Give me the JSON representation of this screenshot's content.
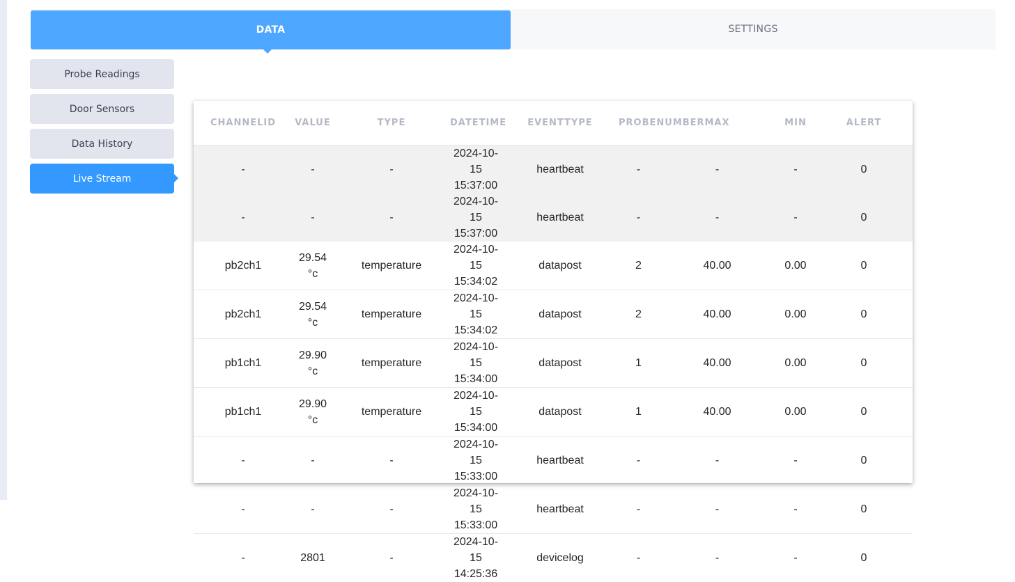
{
  "tabs": {
    "data": "DATA",
    "settings": "SETTINGS"
  },
  "subnav": {
    "probe_readings": "Probe Readings",
    "door_sensors": "Door Sensors",
    "data_history": "Data History",
    "live_stream": "Live Stream"
  },
  "table": {
    "headers": [
      "CHANNELID",
      "VALUE",
      "TYPE",
      "DATETIME",
      "EVENTTYPE",
      "PROBENUMBER",
      "MAX",
      "MIN",
      "ALERT"
    ],
    "rows": [
      [
        "-",
        "-",
        "-",
        "2024-10-15",
        "15:37:00",
        "heartbeat",
        "-",
        "-",
        "-",
        "0"
      ],
      [
        "-",
        "-",
        "-",
        "2024-10-15",
        "15:37:00",
        "heartbeat",
        "-",
        "-",
        "-",
        "0"
      ],
      [
        "pb2ch1",
        "29.54 °c",
        "temperature",
        "2024-10-15",
        "15:34:02",
        "datapost",
        "2",
        "40.00",
        "0.00",
        "0"
      ],
      [
        "pb2ch1",
        "29.54 °c",
        "temperature",
        "2024-10-15",
        "15:34:02",
        "datapost",
        "2",
        "40.00",
        "0.00",
        "0"
      ],
      [
        "pb1ch1",
        "29.90 °c",
        "temperature",
        "2024-10-15",
        "15:34:00",
        "datapost",
        "1",
        "40.00",
        "0.00",
        "0"
      ],
      [
        "pb1ch1",
        "29.90 °c",
        "temperature",
        "2024-10-15",
        "15:34:00",
        "datapost",
        "1",
        "40.00",
        "0.00",
        "0"
      ],
      [
        "-",
        "-",
        "-",
        "2024-10-15",
        "15:33:00",
        "heartbeat",
        "-",
        "-",
        "-",
        "0"
      ],
      [
        "-",
        "-",
        "-",
        "2024-10-15",
        "15:33:00",
        "heartbeat",
        "-",
        "-",
        "-",
        "0"
      ],
      [
        "-",
        "2801",
        "-",
        "2024-10-15",
        "14:25:36",
        "devicelog",
        "-",
        "-",
        "-",
        "0"
      ]
    ]
  },
  "colors": {
    "accent": "#4da6ff",
    "active_subnav": "#3399ff",
    "header_text": "#b5b9c6"
  }
}
